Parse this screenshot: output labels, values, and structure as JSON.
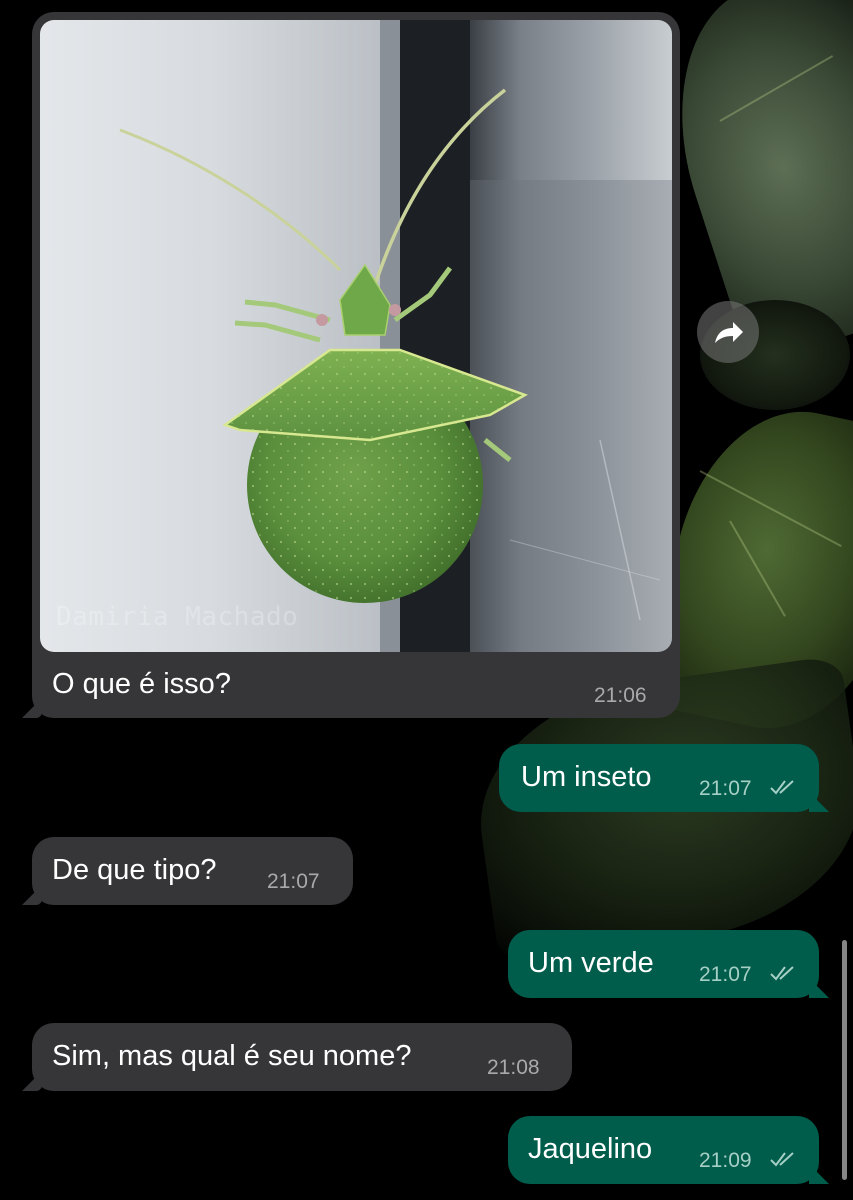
{
  "chat": {
    "image_message": {
      "caption": "O que é isso?",
      "time": "21:06",
      "watermark": "Damiria Machado"
    },
    "messages": [
      {
        "direction": "outgoing",
        "text": "Um inseto",
        "time": "21:07",
        "status": "read"
      },
      {
        "direction": "incoming",
        "text": "De que tipo?",
        "time": "21:07"
      },
      {
        "direction": "outgoing",
        "text": "Um verde",
        "time": "21:07",
        "status": "read"
      },
      {
        "direction": "incoming",
        "text": "Sim, mas qual é seu nome?",
        "time": "21:08"
      },
      {
        "direction": "outgoing",
        "text": "Jaquelino",
        "time": "21:09",
        "status": "read"
      }
    ]
  },
  "icons": {
    "forward": "forward-arrow-icon",
    "read_receipt": "double-check-icon"
  },
  "colors": {
    "incoming_bubble": "#363638",
    "outgoing_bubble": "#005c4b",
    "background": "#000000"
  }
}
